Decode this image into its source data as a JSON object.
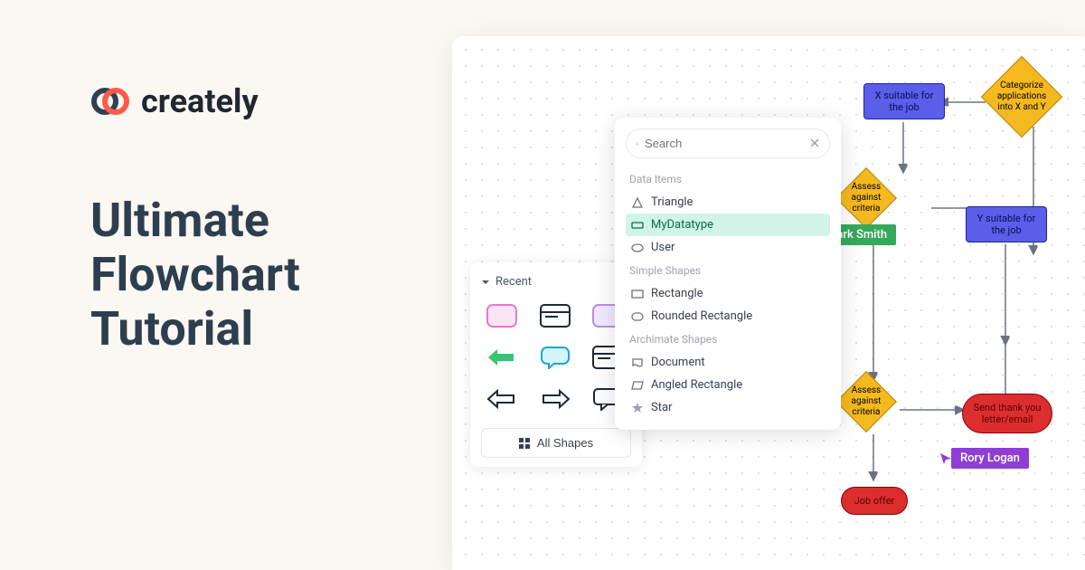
{
  "brand": {
    "name": "creately"
  },
  "headline": "Ultimate Flowchart Tutorial",
  "shapes_sidebar": {
    "recent_label": "Recent",
    "all_shapes_label": "All Shapes"
  },
  "search": {
    "placeholder": "Search",
    "sections": {
      "data_items": "Data Items",
      "simple_shapes": "Simple Shapes",
      "archimate_shapes": "Archimate Shapes"
    },
    "items": {
      "triangle": "Triangle",
      "mydatatype": "MyDatatype",
      "user": "User",
      "rectangle": "Rectangle",
      "rounded_rectangle": "Rounded Rectangle",
      "document": "Document",
      "angled_rectangle": "Angled Rectangle",
      "star": "Star"
    }
  },
  "flowchart": {
    "x_suitable": "X suitable for the job",
    "categorize": "Categorize applications into X and Y",
    "assess1": "Assess against criteria",
    "y_suitable": "Y suitable for the job",
    "assess2": "Assess against criteria",
    "send_thank": "Send thank you letter/email",
    "job_offer": "Job offer"
  },
  "cursors": {
    "mark": "Mark Smith",
    "rory": "Rory Logan"
  }
}
